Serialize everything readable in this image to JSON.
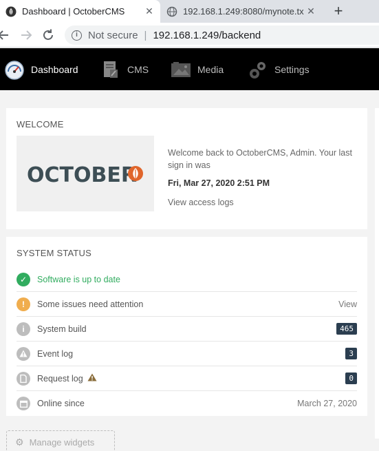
{
  "browser": {
    "tabs": [
      {
        "title": "Dashboard | OctoberCMS",
        "active": true
      },
      {
        "title": "192.168.1.249:8080/mynote.tx",
        "active": false
      }
    ],
    "new_tab_label": "+",
    "close_label": "✕",
    "omnibox": {
      "security_label": "Not secure",
      "separator": "|",
      "url": "192.168.1.249/backend"
    }
  },
  "nav": {
    "items": [
      {
        "label": "Dashboard",
        "icon": "dashboard-gauge-icon",
        "active": true
      },
      {
        "label": "CMS",
        "icon": "cms-icon",
        "active": false
      },
      {
        "label": "Media",
        "icon": "media-icon",
        "active": false
      },
      {
        "label": "Settings",
        "icon": "settings-gears-icon",
        "active": false
      }
    ]
  },
  "welcome": {
    "title": "WELCOME",
    "logo_text": "OCTOBER",
    "message": "Welcome back to OctoberCMS, Admin. Your last sign in was",
    "last_sign_in": "Fri, Mar 27, 2020 2:51 PM",
    "access_logs_link": "View access logs"
  },
  "system_status": {
    "title": "SYSTEM STATUS",
    "rows": [
      {
        "label": "Software is up to date",
        "icon": "check-icon",
        "right": ""
      },
      {
        "label": "Some issues need attention",
        "icon": "exclamation-icon",
        "right": "View"
      },
      {
        "label": "System build",
        "icon": "info-icon",
        "badge": "465"
      },
      {
        "label": "Event log",
        "icon": "warning-icon",
        "badge": "3"
      },
      {
        "label": "Request log",
        "icon": "file-icon",
        "badge": "0"
      },
      {
        "label": "Online since",
        "icon": "calendar-icon",
        "right": "March 27, 2020"
      }
    ]
  },
  "manage_widgets_label": "Manage widgets",
  "colors": {
    "success": "#31ac5f",
    "warning": "#f0ad4e",
    "badge": "#2b3e50",
    "nav_bg": "#000000"
  }
}
